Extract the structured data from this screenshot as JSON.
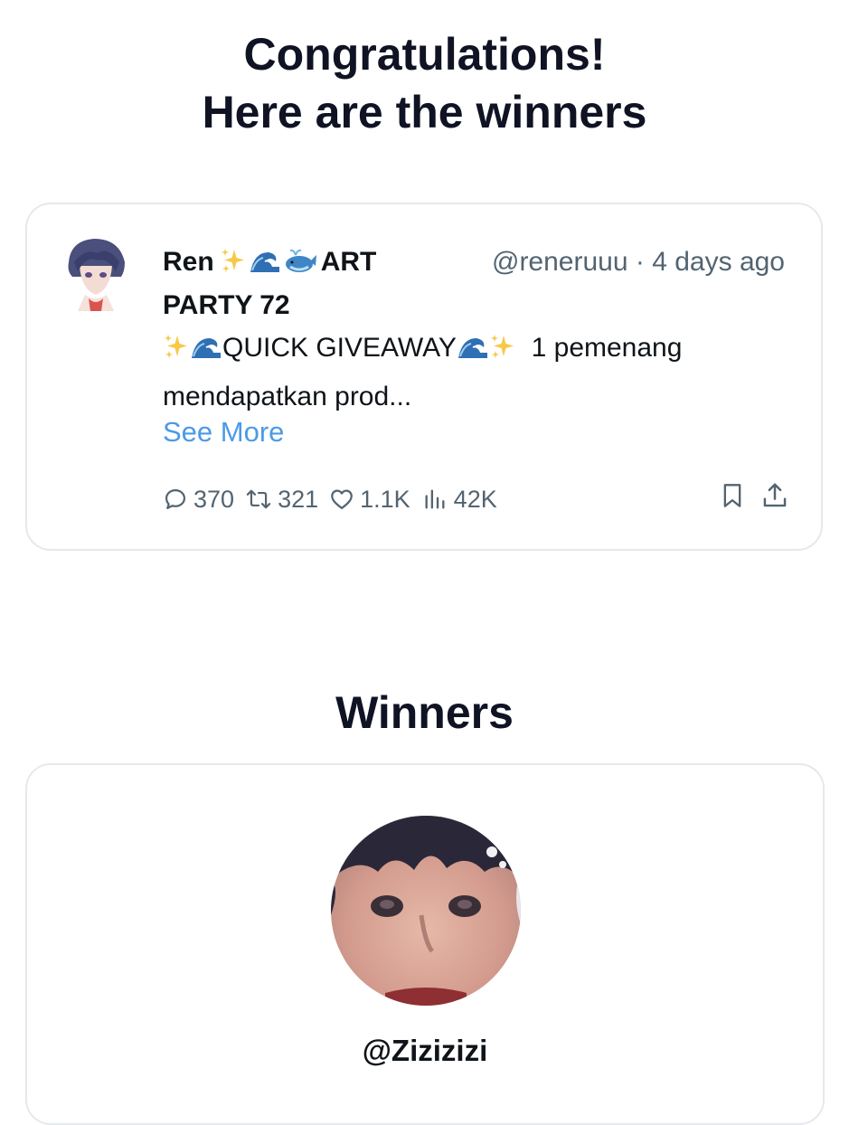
{
  "header": {
    "line1": "Congratulations!",
    "line2": "Here are the winners"
  },
  "tweet": {
    "author_name_start": "Ren",
    "author_emojis": [
      "sparkles",
      "wave",
      "whale"
    ],
    "author_name_rest": "ART PARTY 72",
    "handle": "@reneruuu",
    "separator": "·",
    "time": "4 days ago",
    "text_emojis_before": [
      "sparkles",
      "wave"
    ],
    "text_main": "QUICK GIVEAWAY",
    "text_emojis_after": [
      "wave",
      "sparkles"
    ],
    "text_rest": "1 pemenang mendapatkan prod...",
    "see_more": "See More",
    "stats": {
      "replies": "370",
      "retweets": "321",
      "likes": "1.1K",
      "views": "42K"
    }
  },
  "winners": {
    "title": "Winners",
    "items": [
      {
        "handle": "@Zizizizi"
      }
    ]
  },
  "colors": {
    "heading": "#0f1324",
    "muted": "#536471",
    "link": "#4b9ae6",
    "border": "#e6e8ec"
  }
}
